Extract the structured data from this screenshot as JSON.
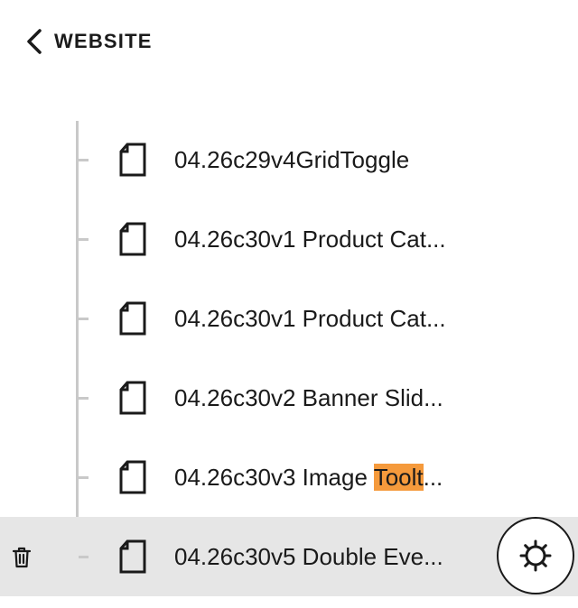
{
  "header": {
    "back_label": "WEBSITE",
    "back_icon": "chevron-left-icon"
  },
  "pages": [
    {
      "label": "04.26c29v4GridToggle"
    },
    {
      "label": "04.26c30v1 Product Cat..."
    },
    {
      "label": "04.26c30v1 Product Cat..."
    },
    {
      "label": "04.26c30v2 Banner Slid..."
    },
    {
      "label_before": "04.26c30v3 Image ",
      "label_highlight": "Toolt",
      "label_after": "..."
    },
    {
      "label": "04.26c30v5 Double Eve...",
      "selected": true
    }
  ],
  "icons": {
    "page": "page-icon",
    "trash": "trash-icon",
    "settings": "gear-icon"
  },
  "colors": {
    "highlight": "#f59a3c",
    "selected_row": "#e6e6e6",
    "tree_line": "#c9c9c9"
  }
}
